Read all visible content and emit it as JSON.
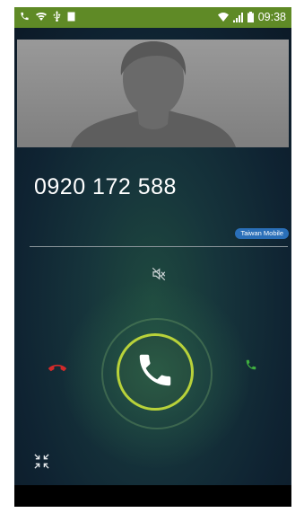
{
  "status_bar": {
    "left_icons": [
      "phone-icon",
      "wifi-icon",
      "usb-icon",
      "image-icon"
    ],
    "right_icons": [
      "wifi-icon",
      "signal-icon",
      "battery-icon"
    ],
    "time": "09:38",
    "color": "#5f8a26"
  },
  "call": {
    "caller_photo": "default-contact-silhouette",
    "number": "0920 172 588",
    "carrier": "Taiwan Mobile"
  },
  "controls": {
    "mute_icon": "speaker-muted-icon",
    "answer_icon": "phone-handset-icon",
    "decline_icon": "phone-hangup-icon",
    "accept_icon": "phone-handset-icon",
    "minimize_icon": "minimize-arrows-icon",
    "answer_ring_color": "#b8d23a",
    "decline_color": "#d22a2a",
    "accept_color": "#3fae3f"
  }
}
